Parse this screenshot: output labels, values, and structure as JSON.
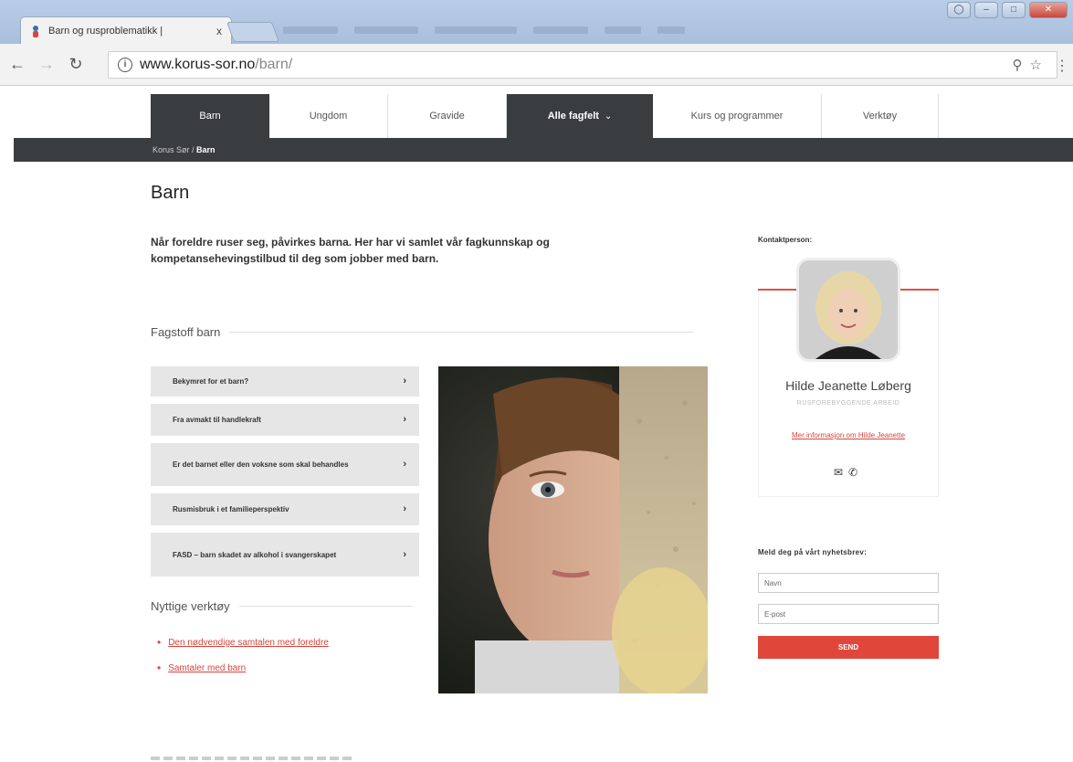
{
  "browser": {
    "tab_title": "Barn og rusproblematikk |",
    "tab_close": "x",
    "url_host": "www.korus-sor.no",
    "url_path": "/barn/"
  },
  "nav": {
    "items": [
      {
        "label": "Barn"
      },
      {
        "label": "Ungdom"
      },
      {
        "label": "Gravide"
      },
      {
        "label": "Alle fagfelt"
      },
      {
        "label": "Kurs og programmer"
      },
      {
        "label": "Verktøy"
      }
    ],
    "dropdown_caret": "⌄"
  },
  "breadcrumb": {
    "parent": "Korus Sør /",
    "current": "Barn"
  },
  "page": {
    "title": "Barn",
    "lead": "Når foreldre ruser seg, påvirkes barna. Her har vi samlet vår fagkunnskap og kompetansehevingstilbud til deg som jobber med barn."
  },
  "fagstoff": {
    "heading": "Fagstoff barn",
    "items": [
      {
        "label": "Bekymret for et barn?"
      },
      {
        "label": "Fra avmakt til handlekraft"
      },
      {
        "label": "Er det barnet eller den voksne som skal behandles"
      },
      {
        "label": "Rusmisbruk i et familieperspektiv"
      },
      {
        "label": "FASD – barn skadet av alkohol i svangerskapet"
      }
    ],
    "chevron": "›"
  },
  "tools": {
    "heading": "Nyttige verktøy",
    "links": [
      {
        "label": "Den nødvendige samtalen med foreldre"
      },
      {
        "label": "Samtaler med barn"
      }
    ]
  },
  "contact": {
    "label": "Kontaktperson:",
    "name": "Hilde Jeanette Løberg",
    "role": "RUSFOREBYGGENDE ARBEID",
    "more_link": "Mer informasjon om Hilde Jeanette",
    "email_icon": "✉",
    "phone_icon": "✆"
  },
  "newsletter": {
    "label": "Meld deg på vårt nyhetsbrev:",
    "name_placeholder": "Navn",
    "email_placeholder": "E-post",
    "send_label": "SEND"
  },
  "colors": {
    "accent": "#e1463b",
    "nav_dark": "#3a3d40"
  }
}
